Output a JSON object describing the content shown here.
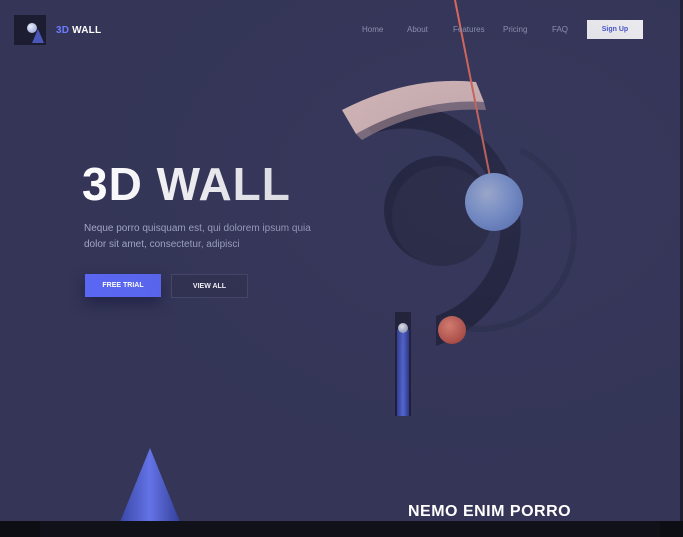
{
  "brand": {
    "name_accent": "3D",
    "name_rest": " WALL"
  },
  "nav": {
    "items": [
      "Home",
      "About",
      "Features",
      "Pricing",
      "FAQ"
    ],
    "signup_label": "Sign Up"
  },
  "hero": {
    "title": "3D WALL",
    "description": "Neque porro quisquam est, qui dolorem ipsum quia dolor sit amet, consectetur, adipisci",
    "primary_button": "FREE TRIAL",
    "secondary_button": "VIEW ALL"
  },
  "section": {
    "title": "NEMO ENIM PORRO"
  },
  "colors": {
    "background": "#343557",
    "accent": "#5a67f2",
    "arc_pink": "#f3cfc9",
    "ball_blue": "#9dbcf4",
    "ball_coral": "#e66a55",
    "string": "#f0705a"
  }
}
